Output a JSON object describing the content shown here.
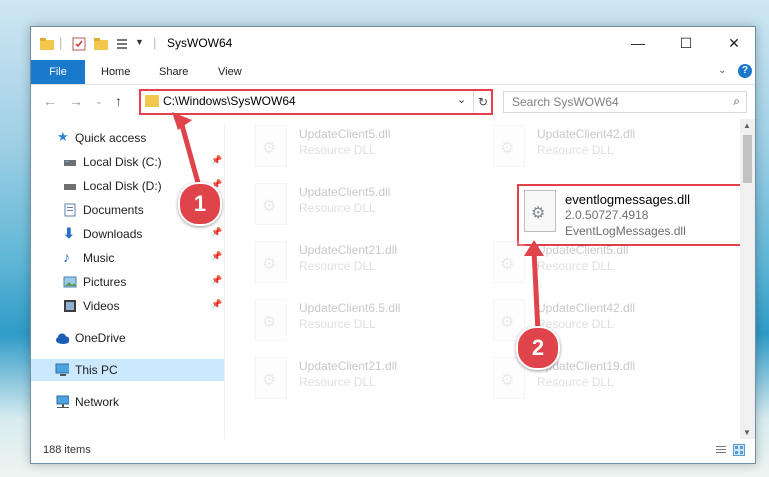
{
  "window": {
    "title": "SysWOW64",
    "controls": {
      "minimize": "—",
      "maximize": "☐",
      "close": "✕"
    }
  },
  "ribbon": {
    "file_tab": "File",
    "tabs": [
      "Home",
      "Share",
      "View"
    ]
  },
  "nav": {
    "path": "C:\\Windows\\SysWOW64",
    "search_placeholder": "Search SysWOW64"
  },
  "sidebar": {
    "items": [
      {
        "label": "Quick access",
        "icon": "star-icon"
      },
      {
        "label": "Local Disk (C:)",
        "icon": "drive-icon",
        "pinned": true
      },
      {
        "label": "Local Disk (D:)",
        "icon": "drive-icon",
        "pinned": true
      },
      {
        "label": "Documents",
        "icon": "documents-icon",
        "pinned": true
      },
      {
        "label": "Downloads",
        "icon": "download-icon",
        "pinned": true
      },
      {
        "label": "Music",
        "icon": "music-icon",
        "pinned": true
      },
      {
        "label": "Pictures",
        "icon": "pictures-icon",
        "pinned": true
      },
      {
        "label": "Videos",
        "icon": "video-icon",
        "pinned": true
      },
      {
        "label": "OneDrive",
        "icon": "cloud-icon"
      },
      {
        "label": "This PC",
        "icon": "computer-icon",
        "selected": true
      },
      {
        "label": "Network",
        "icon": "network-icon"
      }
    ]
  },
  "files": {
    "left": [
      {
        "name": "UpdateClient5.dll",
        "desc": "Resource DLL"
      },
      {
        "name": "UpdateClient5.dll",
        "desc": "Resource DLL"
      },
      {
        "name": "UpdateClient21.dll",
        "desc": "Resource DLL"
      },
      {
        "name": "UpdateClient6.5.dll",
        "desc": "Resource DLL"
      },
      {
        "name": "UpdateClient21.dll",
        "desc": "Resource DLL"
      }
    ],
    "right": [
      {
        "name": "UpdateClient42.dll",
        "desc": "Resource DLL"
      },
      {
        "name": "UpdateClient5.dll",
        "desc": "Resource DLL"
      },
      {
        "name": "UpdateClient42.dll",
        "desc": "Resource DLL"
      },
      {
        "name": "UpdateClient19.dll",
        "desc": "Resource DLL"
      }
    ],
    "highlighted": {
      "name": "eventlogmessages.dll",
      "version": "2.0.50727.4918",
      "desc": "EventLogMessages.dll"
    }
  },
  "status": {
    "item_count": "188 items"
  },
  "callouts": {
    "step1": "1",
    "step2": "2"
  },
  "colors": {
    "accent": "#1979ca",
    "callout": "#e2404a",
    "selected": "#cce8ff"
  }
}
